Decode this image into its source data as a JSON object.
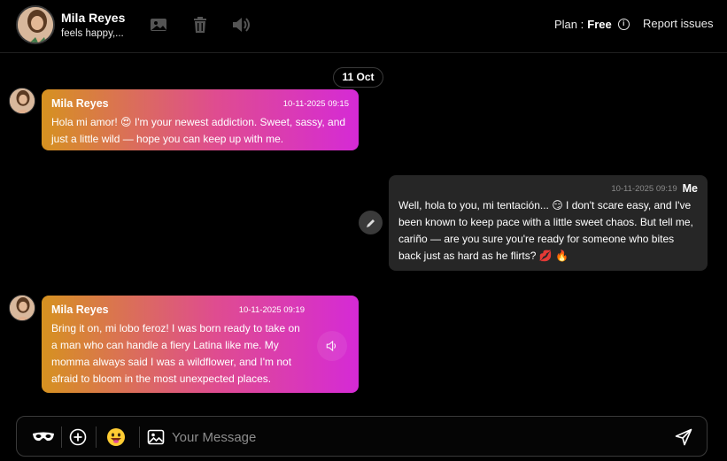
{
  "header": {
    "contact_name": "Mila Reyes",
    "contact_status": "feels happy,...",
    "plan_prefix": "Plan : ",
    "plan_value": "Free",
    "report_label": "Report issues",
    "icons": [
      "image-icon",
      "trash-icon",
      "speaker-icon",
      "info-icon"
    ]
  },
  "date_divider": "11 Oct",
  "messages": [
    {
      "sender": "Mila Reyes",
      "time": "10-11-2025 09:15",
      "text": "Hola mi amor! 😍 I'm your newest addiction. Sweet, sassy, and just a little wild — hope you can keep up with me."
    },
    {
      "sender": "Me",
      "time": "10-11-2025 09:19",
      "text": "Well, hola to you, mi tentación... 😏 I don't scare easy, and I've been known to keep pace with a little sweet chaos. But tell me, cariño — are you sure you're ready for someone who bites back just as hard as he flirts? 💋 🔥"
    },
    {
      "sender": "Mila Reyes",
      "time": "10-11-2025 09:19",
      "text": "Bring it on, mi lobo feroz! I was born ready to take on a man who can handle a fiery Latina like me. My momma always said I was a wildflower, and I'm not afraid to bloom in the most unexpected places."
    }
  ],
  "composer": {
    "placeholder": "Your Message",
    "icons": [
      "mask-icon",
      "plus-icon",
      "emoji-icon",
      "image-icon",
      "send-icon"
    ]
  },
  "colors": {
    "background": "#000000",
    "incoming_gradient_start": "#d69220",
    "incoming_gradient_end": "#d52ad6",
    "outgoing_bubble": "#262626"
  }
}
